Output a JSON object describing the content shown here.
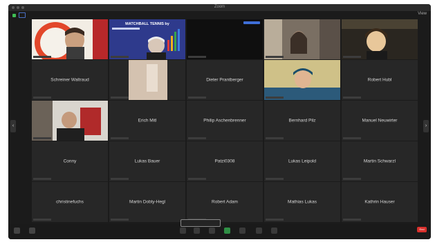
{
  "window": {
    "title": "Zoom"
  },
  "topbar": {
    "view_label": "View"
  },
  "grid": {
    "row1": [
      {
        "kind": "logo-video",
        "caption": ""
      },
      {
        "kind": "banner-video",
        "banner": "MATCHBALL TENNIS by",
        "caption": ""
      },
      {
        "kind": "dark-video",
        "caption": ""
      },
      {
        "kind": "video",
        "caption": ""
      },
      {
        "kind": "video",
        "caption": ""
      }
    ],
    "names": {
      "r2c1": "Schreiner Waltraud",
      "r2c3": "Dieter Prantberger",
      "r2c5": "Robert Hubl",
      "r3c2": "Erich Mitl",
      "r3c3": "Philip Aschenbrenner",
      "r3c4": "Bernhard Pilz",
      "r3c5": "Manuel Neuwirter",
      "r4c1": "Conny",
      "r4c2": "Lukas Bauer",
      "r4c3": "Patzi0308",
      "r4c4": "Lukas Leipold",
      "r4c5": "Martin Schwarzl",
      "r5c1": "christinefuchs",
      "r5c2": "Martin Dobly-Hegl",
      "r5c3": "Robert Adam",
      "r5c4": "Mathias Lukas",
      "r5c5": "Kathrin Hauser"
    }
  },
  "colors": {
    "window_bg": "#1b1b1b",
    "tile_bg": "#272727",
    "end_red": "#d9302c",
    "banner_blue": "#2e3a8c"
  },
  "toolbar": {
    "end_label": "End"
  }
}
